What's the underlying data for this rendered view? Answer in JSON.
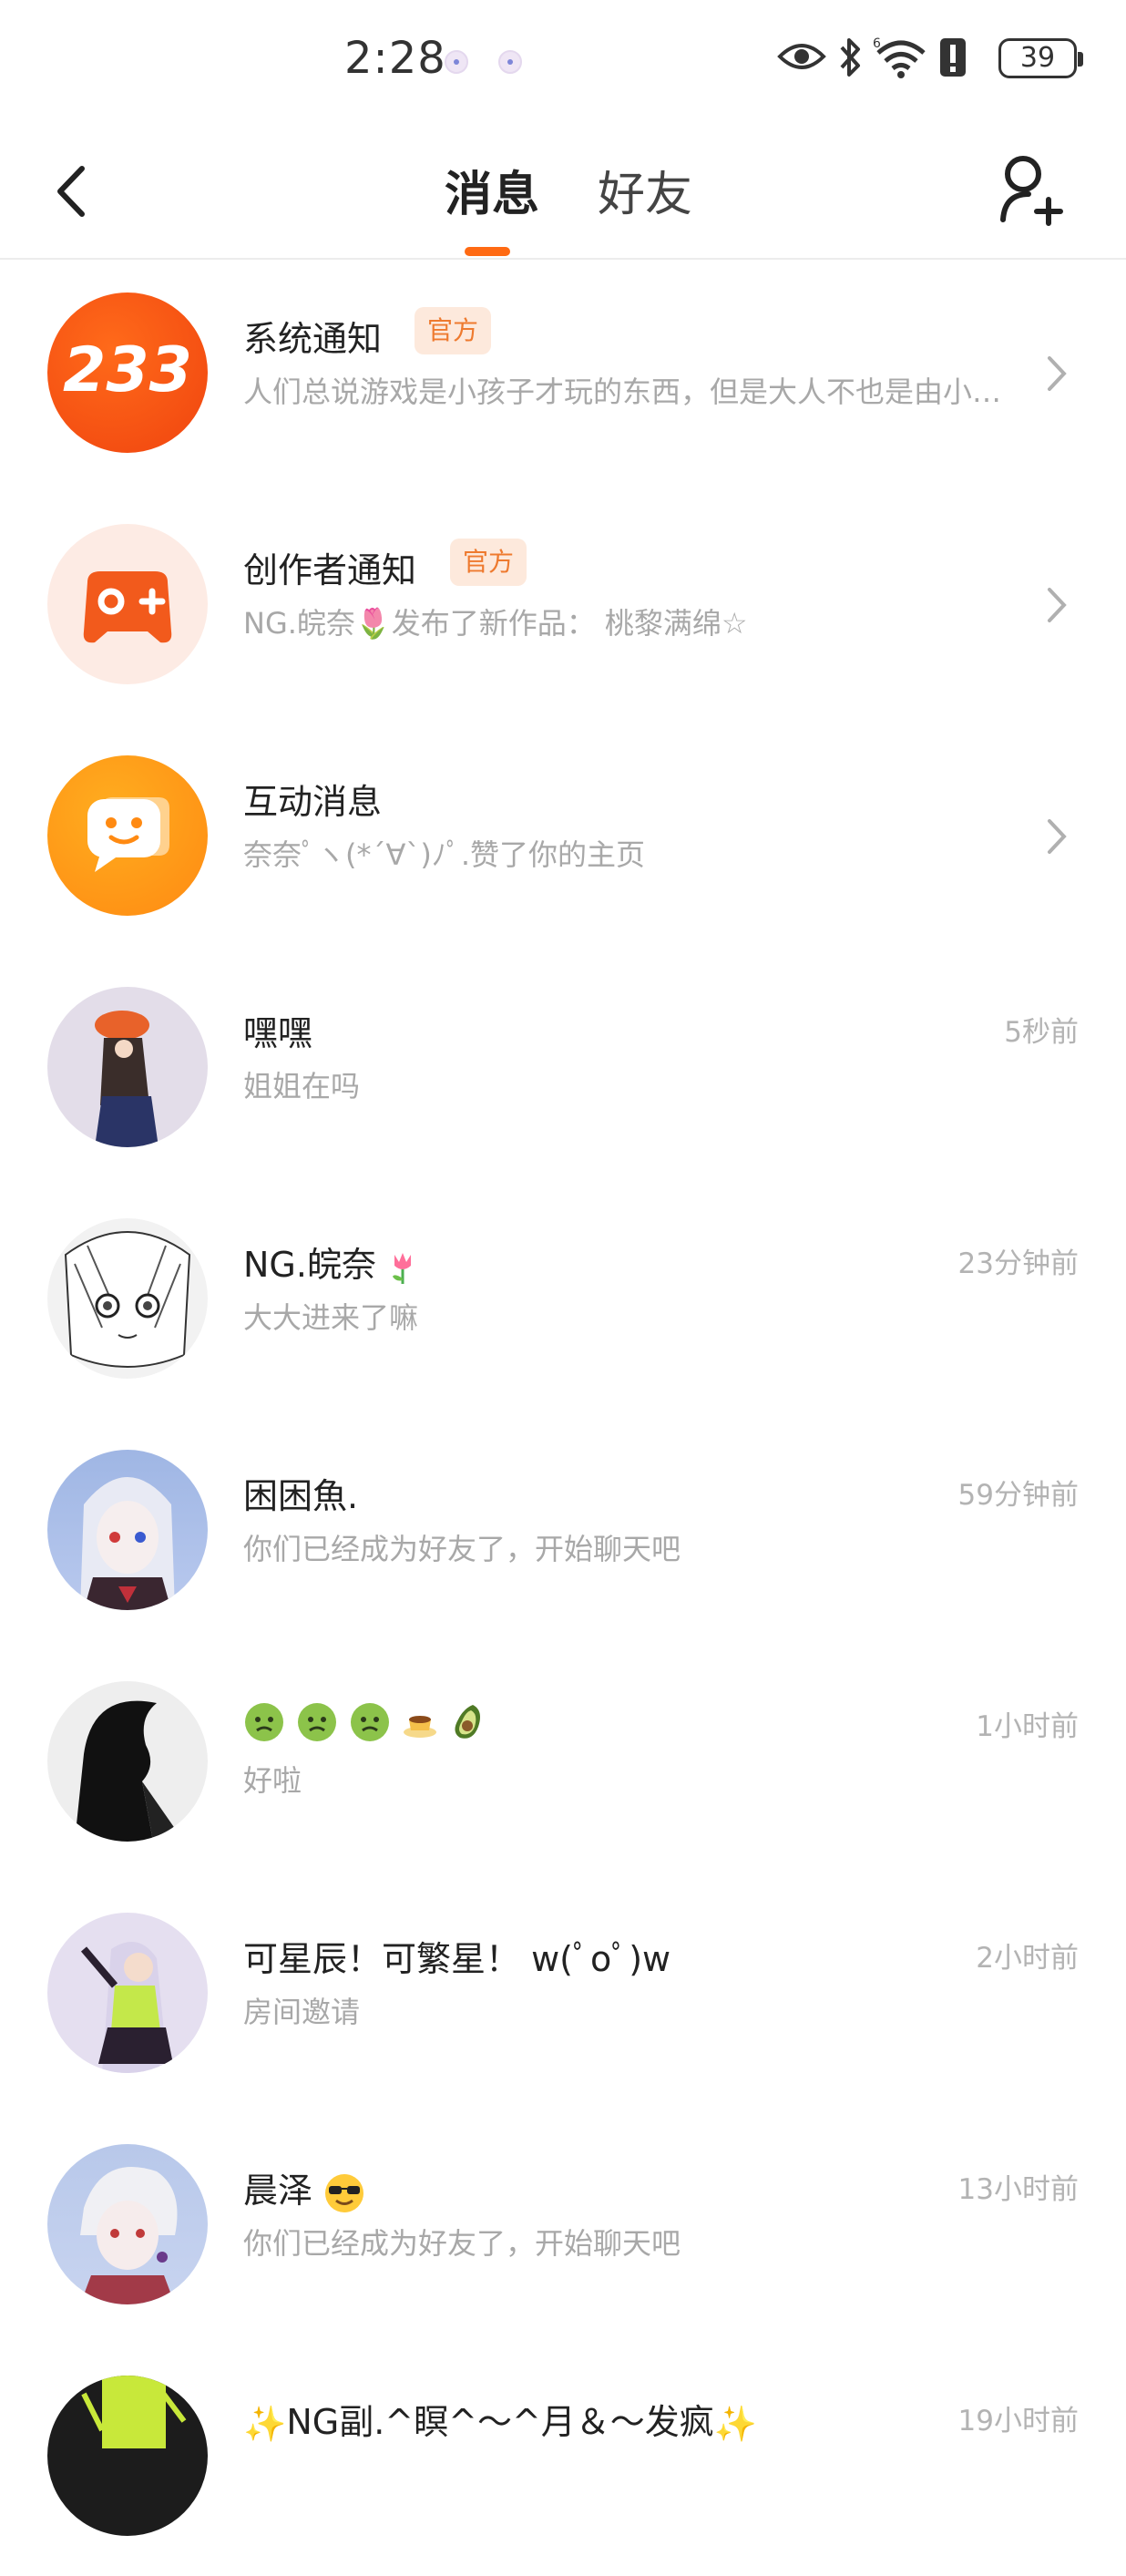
{
  "status_bar": {
    "time": "2:28",
    "battery": "39"
  },
  "header": {
    "tabs": [
      {
        "label": "消息",
        "active": true
      },
      {
        "label": "好友",
        "active": false
      }
    ],
    "accent_color": "#ff6a13"
  },
  "conversations": [
    {
      "title": "系统通知",
      "badge": "官方",
      "preview": "人们总说游戏是小孩子才玩的东西，但是大人不也是由小孩子长成的吗",
      "avatar_icon": "233-logo-icon"
    },
    {
      "title": "创作者通知",
      "badge": "官方",
      "preview": "NG.皖奈🌷发布了新作品：  桃黎满绵☆",
      "avatar_icon": "gamepad-icon"
    },
    {
      "title": "互动消息",
      "preview": "奈奈ﾟヽ(*´∀`)ﾉﾟ.赞了你的主页",
      "avatar_icon": "chat-bubble-icon"
    },
    {
      "title": "嘿嘿",
      "preview": "姐姐在吗",
      "time": "5秒前"
    },
    {
      "title": "NG.皖奈",
      "preview": "大大进来了嘛",
      "time": "23分钟前"
    },
    {
      "title": "困困魚.",
      "preview": "你们已经成为好友了，开始聊天吧",
      "time": "59分钟前"
    },
    {
      "title": "",
      "preview": "好啦",
      "time": "1小时前"
    },
    {
      "title": "可星辰！可繁星！ w(ﾟoﾟ)w",
      "preview": "房间邀请",
      "time": "2小时前"
    },
    {
      "title": "晨泽",
      "preview": "你们已经成为好友了，开始聊天吧",
      "time": "13小时前"
    },
    {
      "title": "NG副.^瞑^～^月＆～发疯",
      "preview": "",
      "time": "19小时前"
    }
  ]
}
